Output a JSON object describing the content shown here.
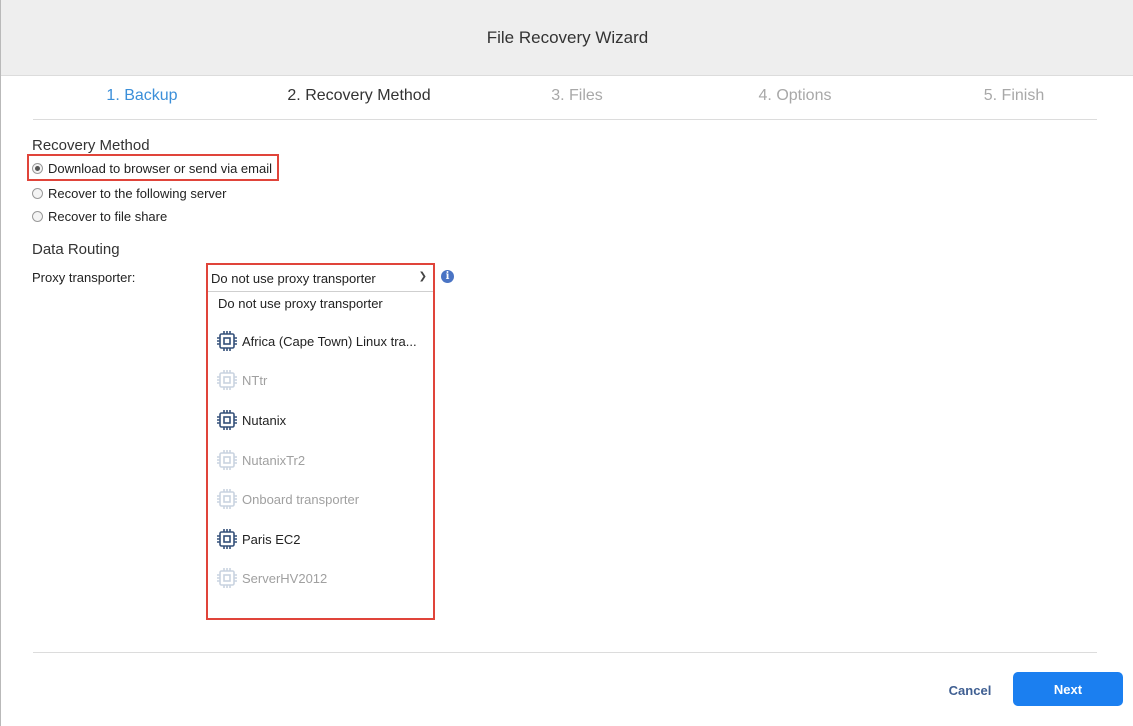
{
  "window": {
    "title": "File Recovery Wizard"
  },
  "steps": [
    {
      "label": "1. Backup",
      "state": "done"
    },
    {
      "label": "2. Recovery Method",
      "state": "current"
    },
    {
      "label": "3. Files",
      "state": "pending"
    },
    {
      "label": "4. Options",
      "state": "pending"
    },
    {
      "label": "5. Finish",
      "state": "pending"
    }
  ],
  "recovery_method": {
    "title": "Recovery Method",
    "options": [
      {
        "label": "Download to browser or send via email",
        "checked": true
      },
      {
        "label": "Recover to the following server",
        "checked": false
      },
      {
        "label": "Recover to file share",
        "checked": false
      }
    ]
  },
  "data_routing": {
    "title": "Data Routing",
    "proxy_label": "Proxy transporter:",
    "selected": "Do not use proxy transporter",
    "info_icon": "i",
    "options": [
      {
        "label": "Do not use proxy transporter",
        "icon": "none",
        "enabled": true
      },
      {
        "label": "Africa (Cape Town) Linux tra...",
        "icon": "chip-icon",
        "enabled": true
      },
      {
        "label": "NTtr",
        "icon": "chip-icon",
        "enabled": false
      },
      {
        "label": "Nutanix",
        "icon": "chip-icon",
        "enabled": true
      },
      {
        "label": "NutanixTr2",
        "icon": "chip-icon",
        "enabled": false
      },
      {
        "label": "Onboard transporter",
        "icon": "chip-icon",
        "enabled": false
      },
      {
        "label": "Paris EC2",
        "icon": "chip-icon",
        "enabled": true
      },
      {
        "label": "ServerHV2012",
        "icon": "chip-icon",
        "enabled": false
      }
    ]
  },
  "footer": {
    "cancel_label": "Cancel",
    "next_label": "Next"
  },
  "colors": {
    "accent": "#1b7ff0",
    "highlight": "#e0443a",
    "step_done": "#3b8fd9",
    "chip_enabled": "#34507a",
    "chip_disabled": "#c9d3e0"
  }
}
